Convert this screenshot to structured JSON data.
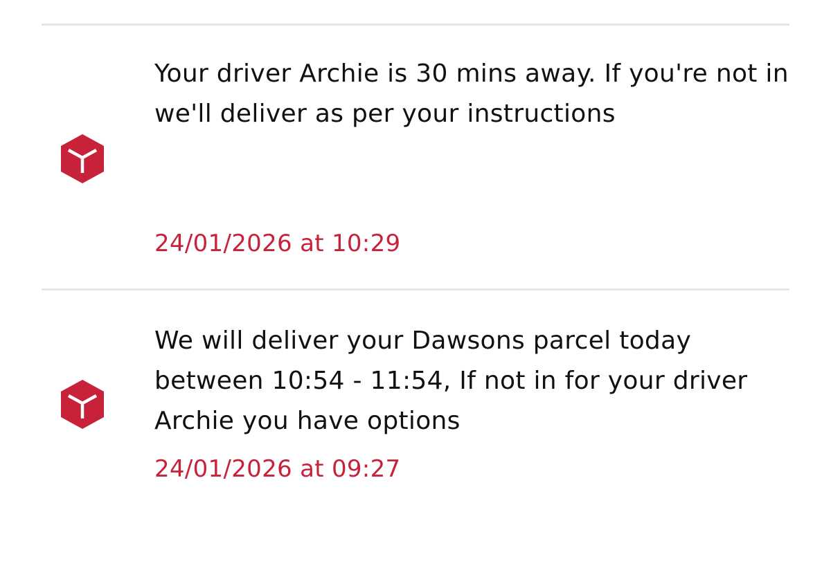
{
  "brand_color": "#c8213a",
  "events": [
    {
      "icon": "parcel-box-icon",
      "message": "Your driver Archie is 30 mins away. If you're not in we'll deliver as per your instructions",
      "timestamp": "24/01/2026 at 10:29"
    },
    {
      "icon": "parcel-box-icon",
      "message": "We will deliver your Dawsons parcel today between 10:54 - 11:54, If not in for your driver Archie you have options",
      "timestamp": "24/01/2026 at 09:27"
    }
  ]
}
